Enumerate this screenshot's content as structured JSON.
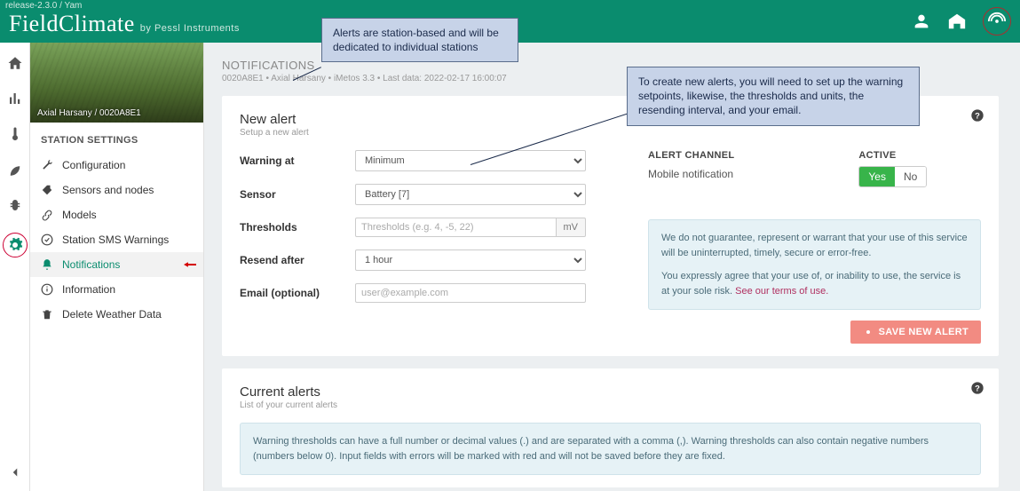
{
  "header": {
    "version": "release-2.3.0 / Yam",
    "brand_main": "FieldClimate",
    "brand_sub": "by Pessl Instruments"
  },
  "sidebar": {
    "station_caption": "Axial Harsany / 0020A8E1",
    "section_title": "STATION SETTINGS",
    "items": {
      "config": "Configuration",
      "sensors": "Sensors and nodes",
      "models": "Models",
      "sms": "Station SMS Warnings",
      "notifications": "Notifications",
      "info": "Information",
      "delete": "Delete Weather Data"
    }
  },
  "page": {
    "title": "NOTIFICATIONS",
    "subtitle": "0020A8E1 • Axial Harsany • iMetos 3.3 • Last data: 2022-02-17 16:00:07"
  },
  "new_alert": {
    "card_title": "New alert",
    "card_sub": "Setup a new alert",
    "labels": {
      "warning_at": "Warning at",
      "sensor": "Sensor",
      "thresholds": "Thresholds",
      "resend": "Resend after",
      "email": "Email (optional)"
    },
    "values": {
      "warning_at": "Minimum",
      "sensor": "Battery [7]",
      "thresholds_placeholder": "Thresholds (e.g. 4, -5, 22)",
      "unit": "mV",
      "resend": "1 hour",
      "email_placeholder": "user@example.com"
    },
    "channel_head": "ALERT CHANNEL",
    "channel_val": "Mobile notification",
    "active_head": "ACTIVE",
    "active_yes": "Yes",
    "active_no": "No",
    "disclaimer_1": "We do not guarantee, represent or warrant that your use of this service will be uninterrupted, timely, secure or error-free.",
    "disclaimer_2a": "You expressly agree that your use of, or inability to use, the service is at your sole risk. ",
    "disclaimer_2link": "See our terms of use.",
    "save_btn": "SAVE NEW ALERT"
  },
  "current_alerts": {
    "title": "Current alerts",
    "sub": "List of your current alerts",
    "info": "Warning thresholds can have a full number or decimal values (.) and are separated with a comma (,). Warning thresholds can also contain negative numbers (numbers below 0). Input fields with errors will be marked with red and will not be saved before they are fixed."
  },
  "callouts": {
    "c1": "Alerts are station-based and will be dedicated to individual stations",
    "c2": "To create new alerts, you will need to set up the warning setpoints, likewise, the thresholds and units, the resending interval, and your email."
  }
}
